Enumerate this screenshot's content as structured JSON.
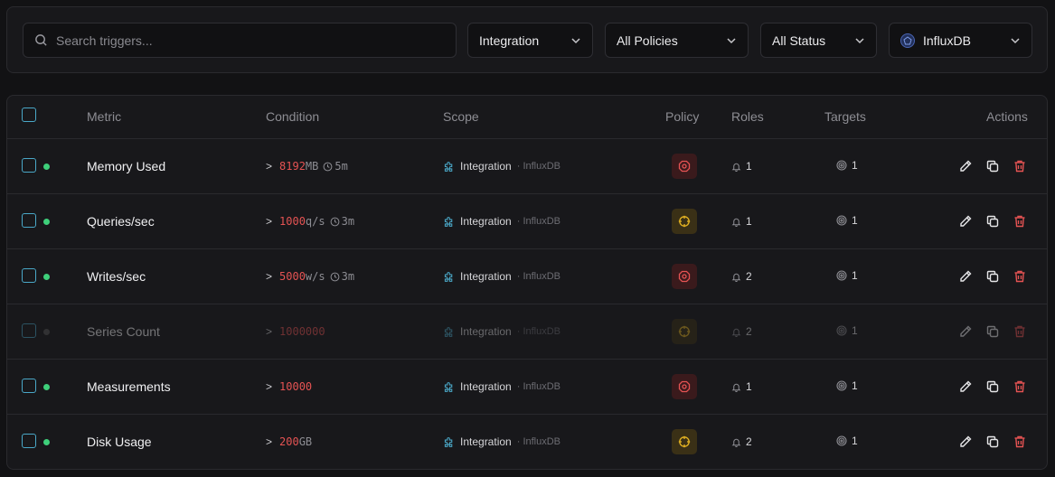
{
  "filters": {
    "search_placeholder": "Search triggers...",
    "integration": "Integration",
    "policies": "All Policies",
    "status": "All Status",
    "datasource": "InfluxDB"
  },
  "table": {
    "headers": {
      "metric": "Metric",
      "condition": "Condition",
      "scope": "Scope",
      "policy": "Policy",
      "roles": "Roles",
      "targets": "Targets",
      "actions": "Actions"
    },
    "rows": [
      {
        "metric": "Memory Used",
        "op": ">",
        "value": "8192",
        "unit": "MB",
        "duration": "5m",
        "scope": "Integration",
        "scope_sub": "· InfluxDB",
        "policy": "critical",
        "roles": "1",
        "targets": "1",
        "enabled": true
      },
      {
        "metric": "Queries/sec",
        "op": ">",
        "value": "1000",
        "unit": "q/s",
        "duration": "3m",
        "scope": "Integration",
        "scope_sub": "· InfluxDB",
        "policy": "warning",
        "roles": "1",
        "targets": "1",
        "enabled": true
      },
      {
        "metric": "Writes/sec",
        "op": ">",
        "value": "5000",
        "unit": "w/s",
        "duration": "3m",
        "scope": "Integration",
        "scope_sub": "· InfluxDB",
        "policy": "critical",
        "roles": "2",
        "targets": "1",
        "enabled": true
      },
      {
        "metric": "Series Count",
        "op": ">",
        "value": "1000000",
        "unit": "",
        "duration": "",
        "scope": "Integration",
        "scope_sub": "· InfluxDB",
        "policy": "warning",
        "roles": "2",
        "targets": "1",
        "enabled": false
      },
      {
        "metric": "Measurements",
        "op": ">",
        "value": "10000",
        "unit": "",
        "duration": "",
        "scope": "Integration",
        "scope_sub": "· InfluxDB",
        "policy": "critical",
        "roles": "1",
        "targets": "1",
        "enabled": true
      },
      {
        "metric": "Disk Usage",
        "op": ">",
        "value": "200",
        "unit": "GB",
        "duration": "",
        "scope": "Integration",
        "scope_sub": "· InfluxDB",
        "policy": "warning",
        "roles": "2",
        "targets": "1",
        "enabled": true
      }
    ]
  },
  "colors": {
    "critical": "#e55353",
    "warning": "#e6b422",
    "enabled_dot": "#3ecf7a",
    "checkbox": "#4aa8c8"
  }
}
